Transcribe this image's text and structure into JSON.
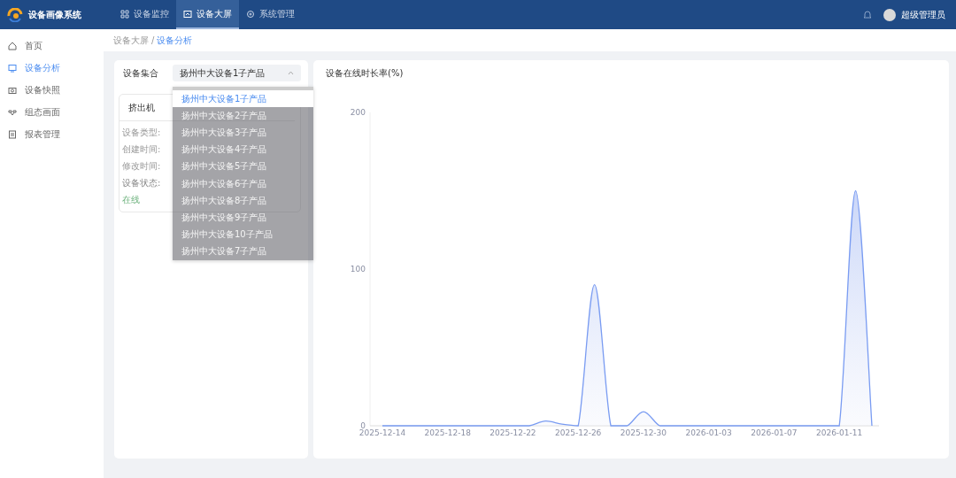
{
  "app": {
    "title": "设备画像系统"
  },
  "top_nav": [
    {
      "label": "设备监控",
      "selected": false
    },
    {
      "label": "设备大屏",
      "selected": true
    },
    {
      "label": "系统管理",
      "selected": false
    }
  ],
  "user": {
    "name": "超级管理员"
  },
  "sidebar": {
    "items": [
      {
        "label": "首页",
        "selected": false
      },
      {
        "label": "设备分析",
        "selected": true
      },
      {
        "label": "设备快照",
        "selected": false
      },
      {
        "label": "组态画面",
        "selected": false
      },
      {
        "label": "报表管理",
        "selected": false
      }
    ]
  },
  "breadcrumb": {
    "separator": "/",
    "items": [
      {
        "label": "设备大屏",
        "selected": false
      },
      {
        "label": "设备分析",
        "selected": true
      }
    ]
  },
  "filter": {
    "label": "设备集合",
    "value": "扬州中大设备1子产品",
    "expanded": true,
    "options": [
      {
        "label": "扬州中大设备1子产品",
        "selected": true
      },
      {
        "label": "扬州中大设备2子产品",
        "selected": false
      },
      {
        "label": "扬州中大设备3子产品",
        "selected": false
      },
      {
        "label": "扬州中大设备4子产品",
        "selected": false
      },
      {
        "label": "扬州中大设备5子产品",
        "selected": false
      },
      {
        "label": "扬州中大设备6子产品",
        "selected": false
      },
      {
        "label": "扬州中大设备8子产品",
        "selected": false
      },
      {
        "label": "扬州中大设备9子产品",
        "selected": false
      },
      {
        "label": "扬州中大设备10子产品",
        "selected": false
      },
      {
        "label": "扬州中大设备7子产品",
        "selected": false
      }
    ]
  },
  "device_card": {
    "title": "挤出机",
    "fields": [
      {
        "label": "设备类型:"
      },
      {
        "label": "创建时间:"
      },
      {
        "label": "修改时间:"
      }
    ],
    "status_label": "设备状态:",
    "status_value": "在线"
  },
  "chart": {
    "title": "设备在线时长率(%)",
    "chart_data": {
      "type": "area",
      "categories": [
        "2025-12-14",
        null,
        null,
        null,
        "2025-12-18",
        null,
        null,
        null,
        "2025-12-22",
        null,
        null,
        null,
        "2025-12-26",
        null,
        null,
        null,
        "2025-12-30",
        null,
        null,
        null,
        "2026-01-03",
        null,
        null,
        null,
        "2026-01-07",
        null,
        null,
        null,
        "2026-01-11",
        null,
        null
      ],
      "series": [
        {
          "color": "#7a9cf2",
          "values": [
            0,
            0,
            0,
            0,
            0,
            0,
            0,
            0,
            0,
            0,
            3,
            1,
            0,
            90,
            0,
            0,
            9,
            0,
            0,
            0,
            0,
            0,
            0,
            0,
            0,
            0,
            0,
            0,
            0,
            150,
            0
          ]
        }
      ],
      "ylim": [
        0,
        200
      ],
      "yticks": [
        0,
        100,
        200
      ]
    }
  }
}
